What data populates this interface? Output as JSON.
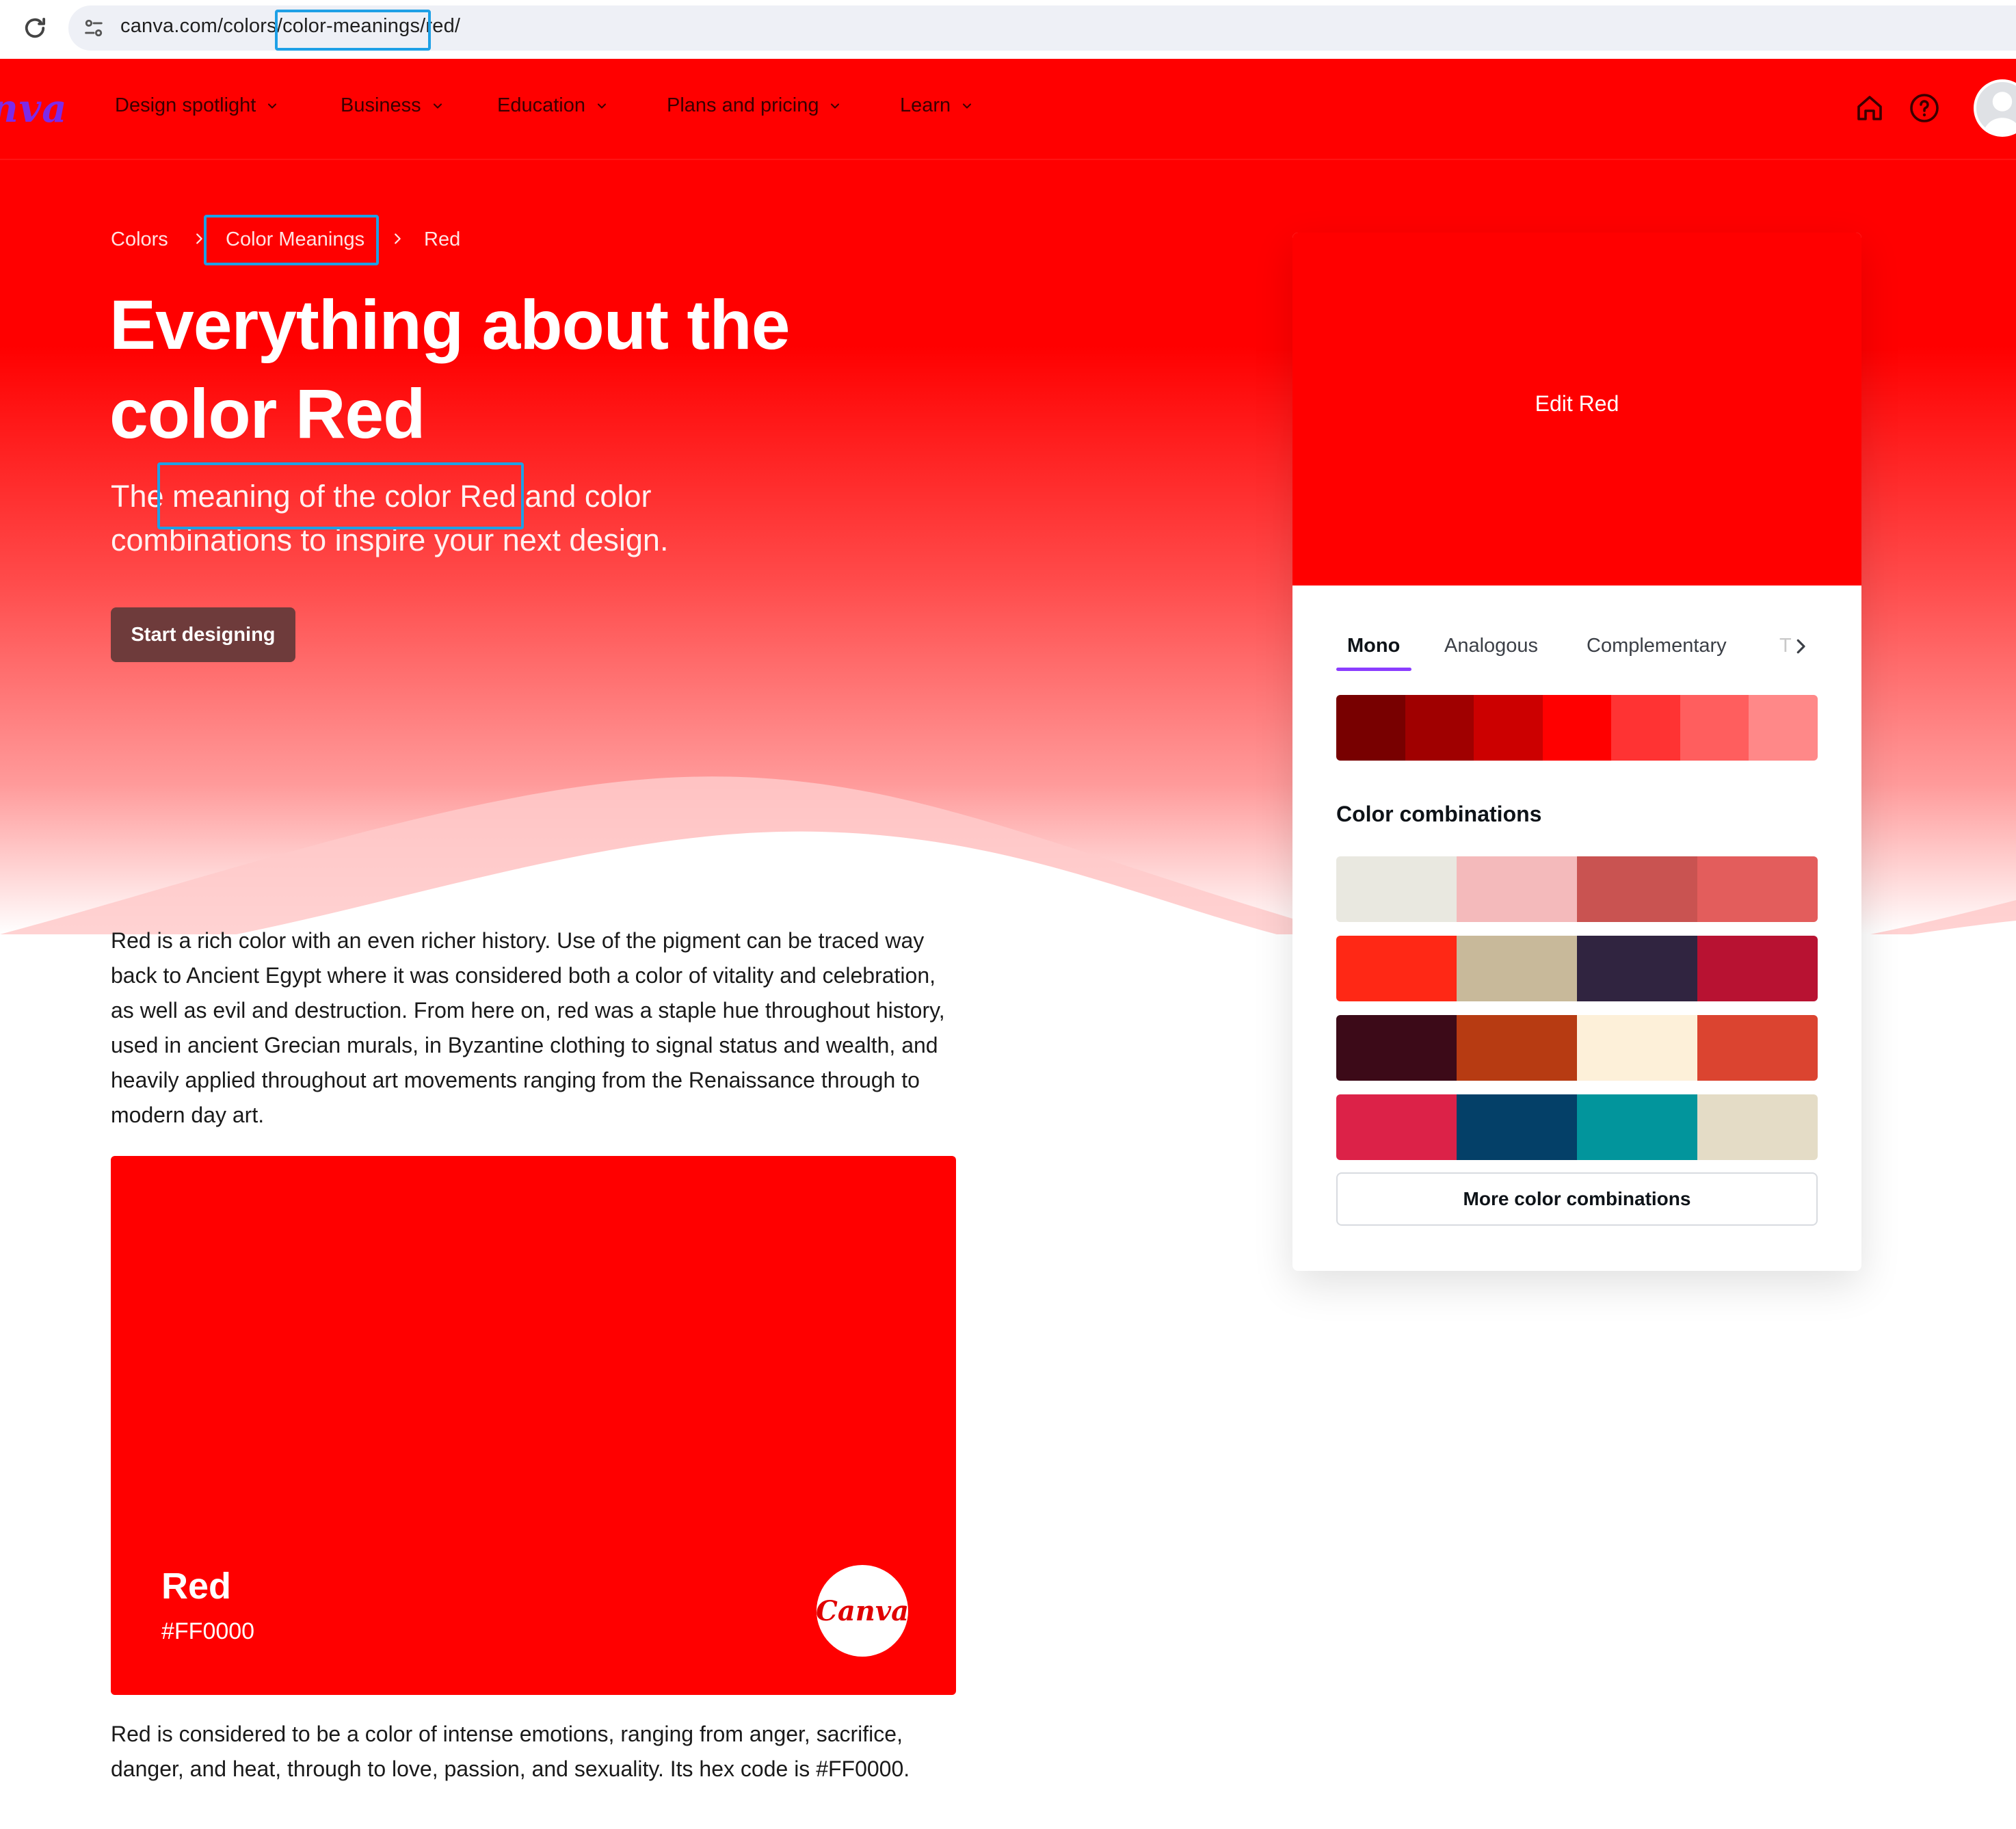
{
  "browser": {
    "url": "canva.com/colors/color-meanings/red/"
  },
  "nav": {
    "logo": "nva",
    "items": [
      {
        "label": "Design spotlight"
      },
      {
        "label": "Business"
      },
      {
        "label": "Education"
      },
      {
        "label": "Plans and pricing"
      },
      {
        "label": "Learn"
      }
    ]
  },
  "breadcrumb": {
    "items": [
      "Colors",
      "Color Meanings",
      "Red"
    ]
  },
  "hero": {
    "title": "Everything about the color Red",
    "subtitle": "The meaning of the color Red and color combinations to inspire your next design.",
    "cta": "Start designing"
  },
  "content": {
    "paragraph1": "Red is a rich color with an even richer history. Use of the pigment can be traced way back to Ancient Egypt where it was considered both a color of vitality and celebration, as well as evil and destruction. From here on, red was a staple hue throughout history, used in ancient Grecian murals, in Byzantine clothing to signal status and wealth, and heavily applied throughout art movements ranging from the Renaissance through to modern day art.",
    "card": {
      "name": "Red",
      "hex": "#FF0000",
      "badge": "Canva",
      "color": "#FF0000"
    },
    "paragraph2": "Red is considered to be a color of intense emotions, ranging from anger, sacrifice, danger, and heat, through to love, passion, and sexuality. Its hex code is #FF0000."
  },
  "panel": {
    "edit_label": "Edit Red",
    "tabs": [
      {
        "label": "Mono",
        "active": true
      },
      {
        "label": "Analogous",
        "active": false
      },
      {
        "label": "Complementary",
        "active": false
      },
      {
        "label": "T",
        "active": false
      }
    ],
    "mono_swatches": [
      "#780000",
      "#a00000",
      "#cc0000",
      "#ff0000",
      "#ff3333",
      "#ff5e5e",
      "#ff8888"
    ],
    "combinations_heading": "Color combinations",
    "combinations": [
      [
        "#e9e8e0",
        "#f4babb",
        "#c95351",
        "#e35d5c"
      ],
      [
        "#ff2815",
        "#c8b99a",
        "#302440",
        "#b81232"
      ],
      [
        "#3c0a18",
        "#b73b12",
        "#fdf0d9",
        "#db4430"
      ],
      [
        "#dc2248",
        "#044068",
        "#02959c",
        "#e4dcc6"
      ]
    ],
    "more_button": "More color combinations"
  },
  "colors": {
    "brand_red": "#FF0000",
    "accent_purple": "#8B3DFF",
    "annotation_blue": "#1EA0E6"
  }
}
